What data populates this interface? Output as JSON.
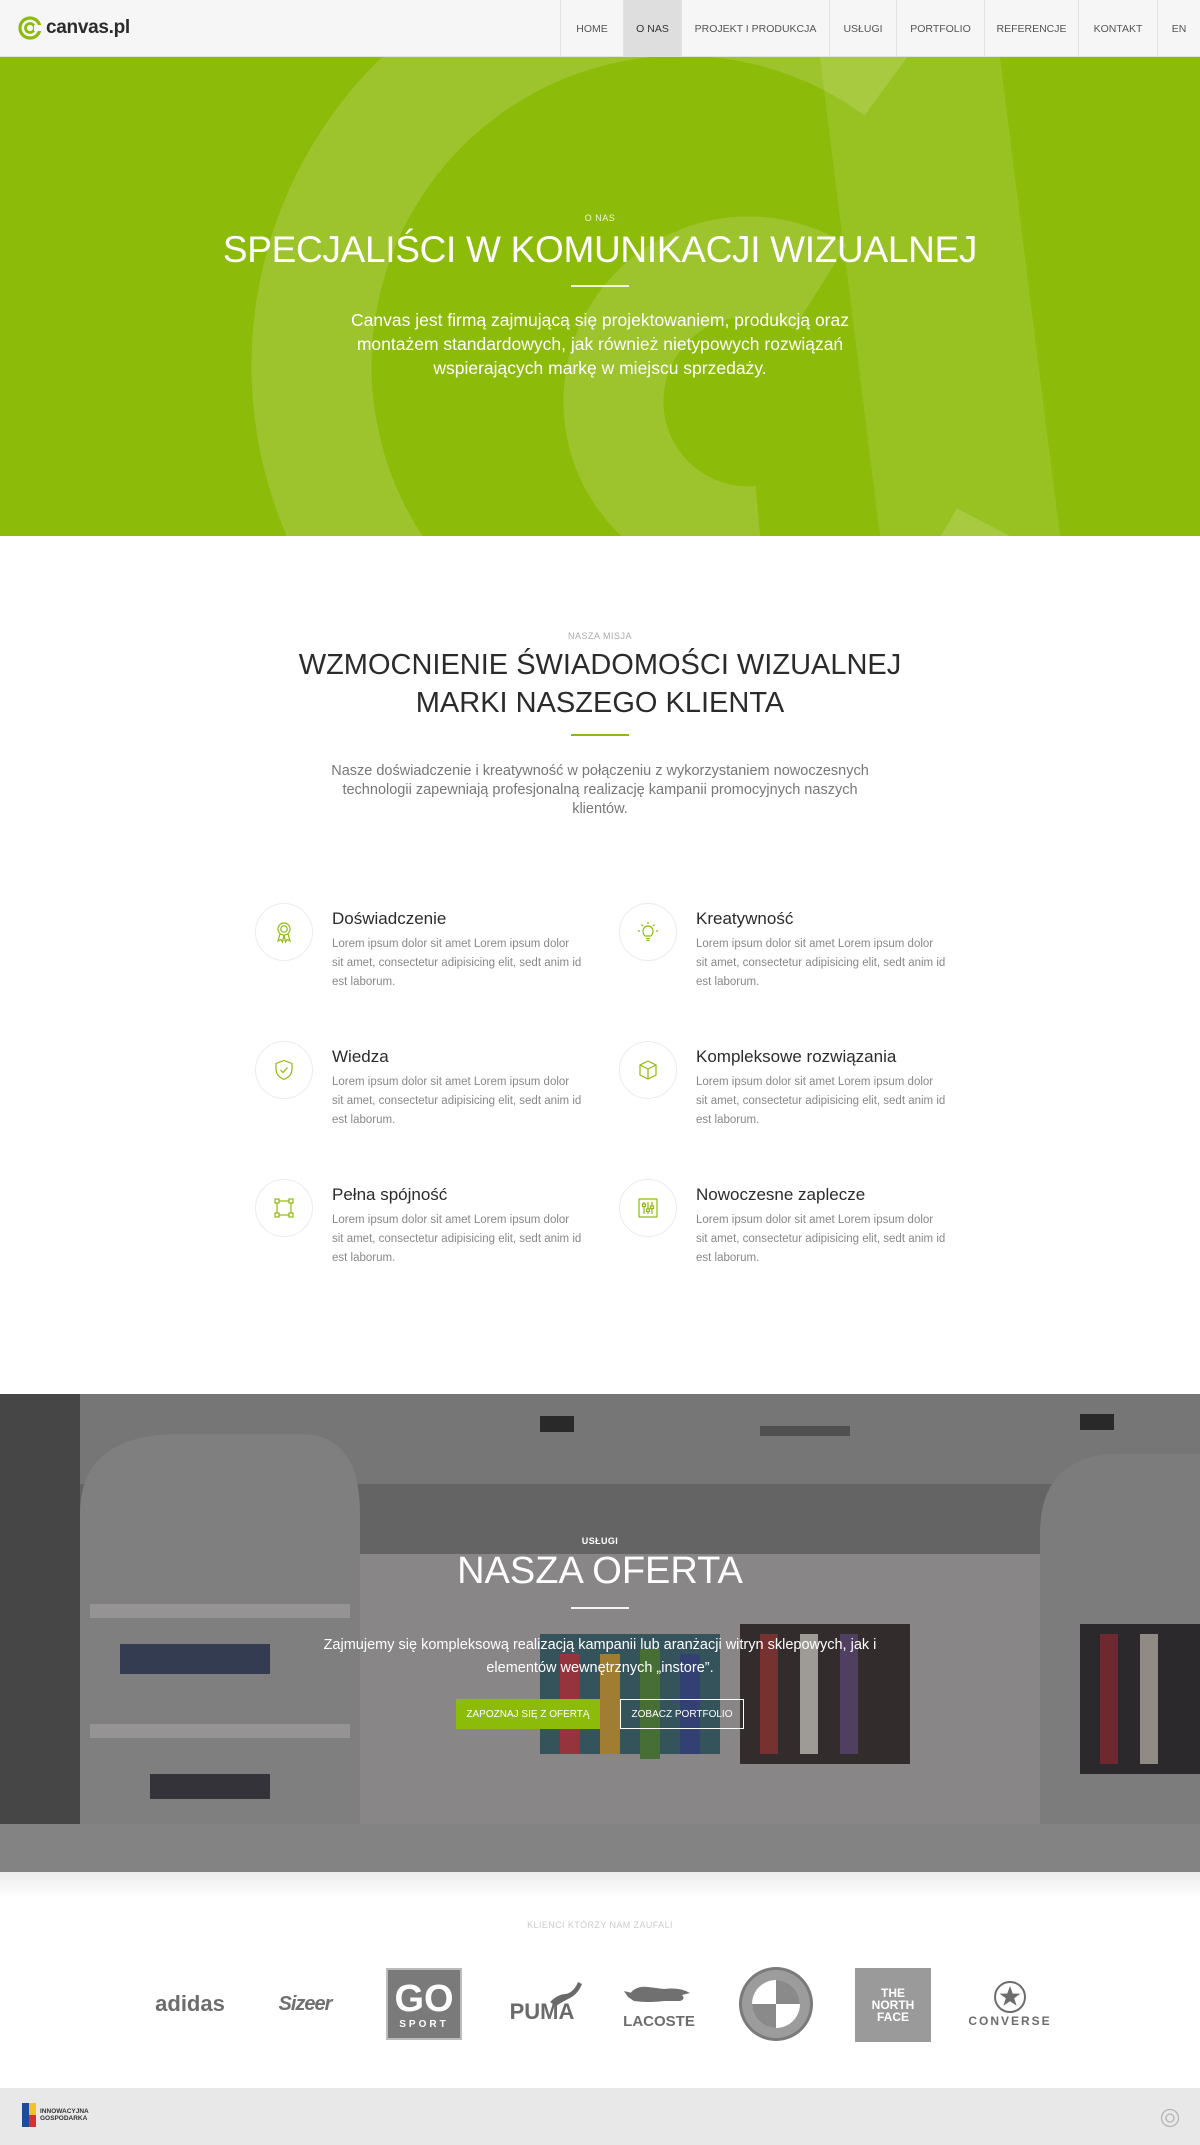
{
  "header": {
    "logo_text": "canvas.pl",
    "nav": [
      {
        "label": "HOME"
      },
      {
        "label": "O NAS",
        "active": true
      },
      {
        "label": "PROJEKT I PRODUKCJA"
      },
      {
        "label": "USŁUGI"
      },
      {
        "label": "PORTFOLIO"
      },
      {
        "label": "REFERENCJE"
      },
      {
        "label": "KONTAKT"
      },
      {
        "label": "EN"
      }
    ]
  },
  "hero": {
    "eyebrow": "O NAS",
    "title": "SPECJALIŚCI W KOMUNIKACJI WIZUALNEJ",
    "text": "Canvas jest firmą zajmującą się projektowaniem, produkcją oraz montażem standardowych, jak również nietypowych rozwiązań wspierających markę w miejscu sprzedaży.",
    "color": "#8dbb0a"
  },
  "mission": {
    "eyebrow": "NASZA MISJA",
    "title_line1": "WZMOCNIENIE ŚWIADOMOŚCI WIZUALNEJ",
    "title_line2": "MARKI NASZEGO KLIENTA",
    "text": "Nasze doświadczenie i kreatywność w połączeniu z wykorzystaniem nowoczesnych technologii zapewniają profesjonalną realizację kampanii promocyjnych naszych klientów.",
    "features": [
      {
        "title": "Doświadczenie",
        "desc": "Lorem ipsum dolor sit amet Lorem ipsum dolor sit amet, consectetur adipisicing elit, sedt anim id est laborum.",
        "icon": "award-icon"
      },
      {
        "title": "Kreatywność",
        "desc": "Lorem ipsum dolor sit amet Lorem ipsum dolor sit amet, consectetur adipisicing elit, sedt anim id est laborum.",
        "icon": "lightbulb-icon"
      },
      {
        "title": "Wiedza",
        "desc": "Lorem ipsum dolor sit amet Lorem ipsum dolor sit amet, consectetur adipisicing elit, sedt anim id est laborum.",
        "icon": "shield-check-icon"
      },
      {
        "title": "Kompleksowe rozwiązania",
        "desc": "Lorem ipsum dolor sit amet Lorem ipsum dolor sit amet, consectetur adipisicing elit, sedt anim id est laborum.",
        "icon": "box-icon"
      },
      {
        "title": "Pełna spójność",
        "desc": "Lorem ipsum dolor sit amet Lorem ipsum dolor sit amet, consectetur adipisicing elit, sedt anim id est laborum.",
        "icon": "vector-square-icon"
      },
      {
        "title": "Nowoczesne zaplecze",
        "desc": "Lorem ipsum dolor sit amet Lorem ipsum dolor sit amet, consectetur adipisicing elit, sedt anim id est laborum.",
        "icon": "sliders-icon"
      }
    ]
  },
  "offer": {
    "eyebrow": "USŁUGI",
    "title": "NASZA OFERTA",
    "text": "Zajmujemy się kompleksową realizacją kampanii lub aranżacji witryn sklepowych, jak i elementów wewnętrznych „instore”.",
    "btn_primary": "ZAPOZNAJ SIĘ Z OFERTĄ",
    "btn_secondary": "ZOBACZ PORTFOLIO"
  },
  "clients": {
    "eyebrow": "KLIENCI KTÓRZY NAM ZAUFALI",
    "logos": [
      {
        "name": "adidas",
        "text": "adidas"
      },
      {
        "name": "sizeer",
        "text": "Sizeer"
      },
      {
        "name": "go-sport",
        "text": "GO",
        "sub": "SPORT"
      },
      {
        "name": "puma",
        "text": "PUMA"
      },
      {
        "name": "lacoste",
        "text": "LACOSTE"
      },
      {
        "name": "bmw",
        "text": "BMW"
      },
      {
        "name": "the-north-face",
        "text": "THE NORTH FACE"
      },
      {
        "name": "converse",
        "text": "CONVERSE"
      }
    ]
  },
  "footer": {
    "eu_text_line1": "INNOWACYJNA",
    "eu_text_line2": "GOSPODARKA"
  }
}
